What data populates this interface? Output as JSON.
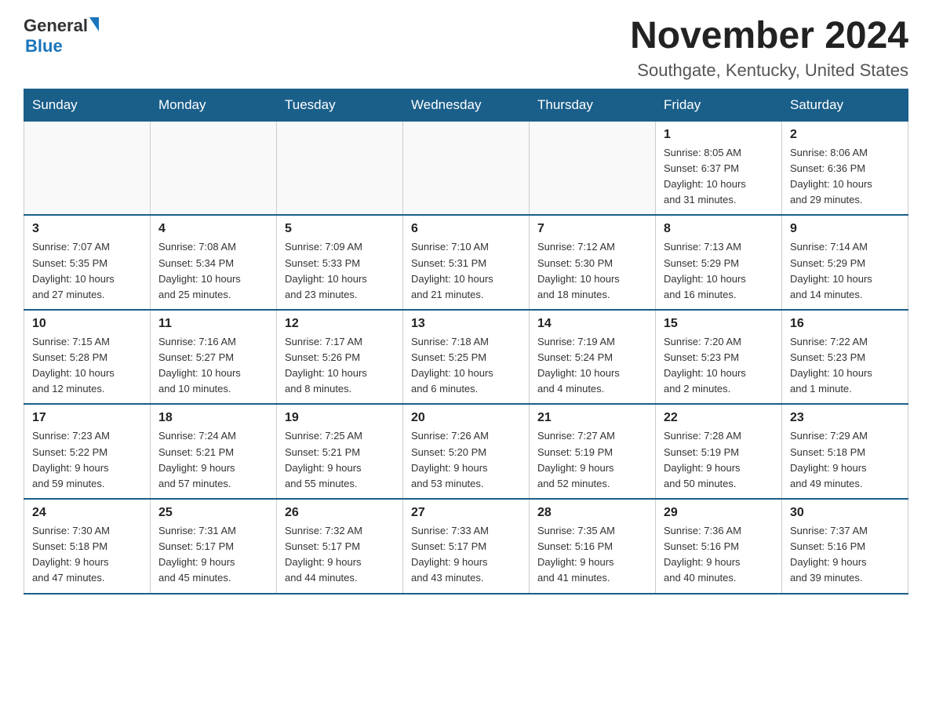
{
  "header": {
    "logo_general": "General",
    "logo_blue": "Blue",
    "month_title": "November 2024",
    "location": "Southgate, Kentucky, United States"
  },
  "days_of_week": [
    "Sunday",
    "Monday",
    "Tuesday",
    "Wednesday",
    "Thursday",
    "Friday",
    "Saturday"
  ],
  "weeks": [
    [
      {
        "day": "",
        "info": ""
      },
      {
        "day": "",
        "info": ""
      },
      {
        "day": "",
        "info": ""
      },
      {
        "day": "",
        "info": ""
      },
      {
        "day": "",
        "info": ""
      },
      {
        "day": "1",
        "info": "Sunrise: 8:05 AM\nSunset: 6:37 PM\nDaylight: 10 hours\nand 31 minutes."
      },
      {
        "day": "2",
        "info": "Sunrise: 8:06 AM\nSunset: 6:36 PM\nDaylight: 10 hours\nand 29 minutes."
      }
    ],
    [
      {
        "day": "3",
        "info": "Sunrise: 7:07 AM\nSunset: 5:35 PM\nDaylight: 10 hours\nand 27 minutes."
      },
      {
        "day": "4",
        "info": "Sunrise: 7:08 AM\nSunset: 5:34 PM\nDaylight: 10 hours\nand 25 minutes."
      },
      {
        "day": "5",
        "info": "Sunrise: 7:09 AM\nSunset: 5:33 PM\nDaylight: 10 hours\nand 23 minutes."
      },
      {
        "day": "6",
        "info": "Sunrise: 7:10 AM\nSunset: 5:31 PM\nDaylight: 10 hours\nand 21 minutes."
      },
      {
        "day": "7",
        "info": "Sunrise: 7:12 AM\nSunset: 5:30 PM\nDaylight: 10 hours\nand 18 minutes."
      },
      {
        "day": "8",
        "info": "Sunrise: 7:13 AM\nSunset: 5:29 PM\nDaylight: 10 hours\nand 16 minutes."
      },
      {
        "day": "9",
        "info": "Sunrise: 7:14 AM\nSunset: 5:29 PM\nDaylight: 10 hours\nand 14 minutes."
      }
    ],
    [
      {
        "day": "10",
        "info": "Sunrise: 7:15 AM\nSunset: 5:28 PM\nDaylight: 10 hours\nand 12 minutes."
      },
      {
        "day": "11",
        "info": "Sunrise: 7:16 AM\nSunset: 5:27 PM\nDaylight: 10 hours\nand 10 minutes."
      },
      {
        "day": "12",
        "info": "Sunrise: 7:17 AM\nSunset: 5:26 PM\nDaylight: 10 hours\nand 8 minutes."
      },
      {
        "day": "13",
        "info": "Sunrise: 7:18 AM\nSunset: 5:25 PM\nDaylight: 10 hours\nand 6 minutes."
      },
      {
        "day": "14",
        "info": "Sunrise: 7:19 AM\nSunset: 5:24 PM\nDaylight: 10 hours\nand 4 minutes."
      },
      {
        "day": "15",
        "info": "Sunrise: 7:20 AM\nSunset: 5:23 PM\nDaylight: 10 hours\nand 2 minutes."
      },
      {
        "day": "16",
        "info": "Sunrise: 7:22 AM\nSunset: 5:23 PM\nDaylight: 10 hours\nand 1 minute."
      }
    ],
    [
      {
        "day": "17",
        "info": "Sunrise: 7:23 AM\nSunset: 5:22 PM\nDaylight: 9 hours\nand 59 minutes."
      },
      {
        "day": "18",
        "info": "Sunrise: 7:24 AM\nSunset: 5:21 PM\nDaylight: 9 hours\nand 57 minutes."
      },
      {
        "day": "19",
        "info": "Sunrise: 7:25 AM\nSunset: 5:21 PM\nDaylight: 9 hours\nand 55 minutes."
      },
      {
        "day": "20",
        "info": "Sunrise: 7:26 AM\nSunset: 5:20 PM\nDaylight: 9 hours\nand 53 minutes."
      },
      {
        "day": "21",
        "info": "Sunrise: 7:27 AM\nSunset: 5:19 PM\nDaylight: 9 hours\nand 52 minutes."
      },
      {
        "day": "22",
        "info": "Sunrise: 7:28 AM\nSunset: 5:19 PM\nDaylight: 9 hours\nand 50 minutes."
      },
      {
        "day": "23",
        "info": "Sunrise: 7:29 AM\nSunset: 5:18 PM\nDaylight: 9 hours\nand 49 minutes."
      }
    ],
    [
      {
        "day": "24",
        "info": "Sunrise: 7:30 AM\nSunset: 5:18 PM\nDaylight: 9 hours\nand 47 minutes."
      },
      {
        "day": "25",
        "info": "Sunrise: 7:31 AM\nSunset: 5:17 PM\nDaylight: 9 hours\nand 45 minutes."
      },
      {
        "day": "26",
        "info": "Sunrise: 7:32 AM\nSunset: 5:17 PM\nDaylight: 9 hours\nand 44 minutes."
      },
      {
        "day": "27",
        "info": "Sunrise: 7:33 AM\nSunset: 5:17 PM\nDaylight: 9 hours\nand 43 minutes."
      },
      {
        "day": "28",
        "info": "Sunrise: 7:35 AM\nSunset: 5:16 PM\nDaylight: 9 hours\nand 41 minutes."
      },
      {
        "day": "29",
        "info": "Sunrise: 7:36 AM\nSunset: 5:16 PM\nDaylight: 9 hours\nand 40 minutes."
      },
      {
        "day": "30",
        "info": "Sunrise: 7:37 AM\nSunset: 5:16 PM\nDaylight: 9 hours\nand 39 minutes."
      }
    ]
  ]
}
